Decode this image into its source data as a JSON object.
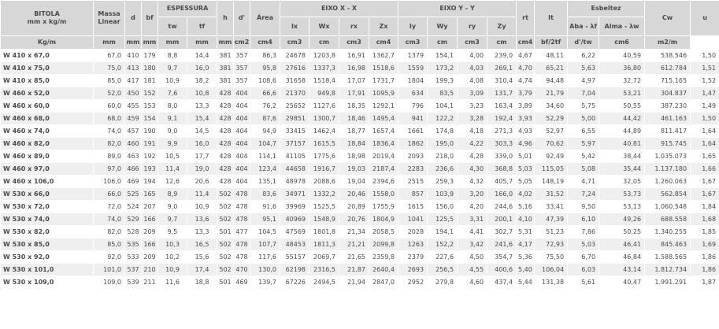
{
  "headers": {
    "bitola": "BITOLA",
    "bitola_unit": "mm x kg/m",
    "massa": "Massa Linear",
    "d": "d",
    "bf": "bf",
    "espessura": "ESPESSURA",
    "tw": "tw",
    "tf": "tf",
    "h": "h",
    "dlinha": "d'",
    "area": "Área",
    "eixo_x": "EIXO X - X",
    "ix": "Ix",
    "wx": "Wx",
    "rx": "rx",
    "zx": "Zx",
    "eixo_y": "EIXO Y - Y",
    "iy": "Iy",
    "wy": "Wy",
    "ry": "ry",
    "zy": "Zy",
    "rt": "rt",
    "it": "It",
    "esbeltez": "Esbeltez",
    "aba": "Aba - λf",
    "alma": "Alma - λw",
    "cw": "Cw",
    "u": "u"
  },
  "units": [
    "Kg/m",
    "mm",
    "mm",
    "mm",
    "mm",
    "mm",
    "mm",
    "cm2",
    "cm4",
    "cm3",
    "cm",
    "cm3",
    "cm4",
    "cm3",
    "cm",
    "cm3",
    "cm",
    "cm4",
    "bf/2tf",
    "d'/tw",
    "cm6",
    "m2/m"
  ],
  "rows": [
    [
      "W 410 x 67,0",
      "67,0",
      "410",
      "179",
      "8,8",
      "14,4",
      "381",
      "357",
      "86,3",
      "24678",
      "1203,8",
      "16,91",
      "1362,7",
      "1379",
      "154,1",
      "4,00",
      "239,0",
      "4,67",
      "48,11",
      "6,22",
      "40,59",
      "538.546",
      "1,50"
    ],
    [
      "W 410 x 75,0",
      "75,0",
      "413",
      "180",
      "9,7",
      "16,0",
      "381",
      "357",
      "95,8",
      "27616",
      "1337,3",
      "16,98",
      "1518,6",
      "1559",
      "173,2",
      "4,03",
      "269,1",
      "4,70",
      "65,21",
      "5,63",
      "36,80",
      "612.784",
      "1,51"
    ],
    [
      "W 410 x 85,0",
      "85,0",
      "417",
      "181",
      "10,9",
      "18,2",
      "381",
      "357",
      "108,6",
      "31658",
      "1518,4",
      "17,07",
      "1731,7",
      "1804",
      "199,3",
      "4,08",
      "310,4",
      "4,74",
      "94,48",
      "4,97",
      "32,72",
      "715.165",
      "1,52"
    ],
    [
      "W 460 x 52,0",
      "52,0",
      "450",
      "152",
      "7,6",
      "10,8",
      "428",
      "404",
      "66,6",
      "21370",
      "949,8",
      "17,91",
      "1095,9",
      "634",
      "83,5",
      "3,09",
      "131,7",
      "3,79",
      "21,79",
      "7,04",
      "53,21",
      "304.837",
      "1,47"
    ],
    [
      "W 460 x 60,0",
      "60,0",
      "455",
      "153",
      "8,0",
      "13,3",
      "428",
      "404",
      "76,2",
      "25652",
      "1127,6",
      "18,35",
      "1292,1",
      "796",
      "104,1",
      "3,23",
      "163,4",
      "3,89",
      "34,60",
      "5,75",
      "50,55",
      "387.230",
      "1,49"
    ],
    [
      "W 460 x 68,0",
      "68,0",
      "459",
      "154",
      "9,1",
      "15,4",
      "428",
      "404",
      "87,6",
      "29851",
      "1300,7",
      "18,46",
      "1495,4",
      "941",
      "122,2",
      "3,28",
      "192,4",
      "3,93",
      "52,29",
      "5,00",
      "44,42",
      "461.163",
      "1,50"
    ],
    [
      "W 460 x 74,0",
      "74,0",
      "457",
      "190",
      "9,0",
      "14,5",
      "428",
      "404",
      "94,9",
      "33415",
      "1462,4",
      "18,77",
      "1657,4",
      "1661",
      "174,8",
      "4,18",
      "271,3",
      "4,93",
      "52,97",
      "6,55",
      "44,89",
      "811.417",
      "1,64"
    ],
    [
      "W 460 x 82,0",
      "82,0",
      "460",
      "191",
      "9,9",
      "16,0",
      "428",
      "404",
      "104,7",
      "37157",
      "1615,5",
      "18,84",
      "1836,4",
      "1862",
      "195,0",
      "4,22",
      "303,3",
      "4,96",
      "70,62",
      "5,97",
      "40,81",
      "915.745",
      "1,64"
    ],
    [
      "W 460 x 89,0",
      "89,0",
      "463",
      "192",
      "10,5",
      "17,7",
      "428",
      "404",
      "114,1",
      "41105",
      "1775,6",
      "18,98",
      "2019,4",
      "2093",
      "218,0",
      "4,28",
      "339,0",
      "5,01",
      "92,49",
      "5,42",
      "38,44",
      "1.035.073",
      "1,65"
    ],
    [
      "W 460 x 97,0",
      "97,0",
      "466",
      "193",
      "11,4",
      "19,0",
      "428",
      "404",
      "123,4",
      "44658",
      "1916,7",
      "19,03",
      "2187,4",
      "2283",
      "236,6",
      "4,30",
      "368,8",
      "5,03",
      "115,05",
      "5,08",
      "35,44",
      "1.137.180",
      "1,66"
    ],
    [
      "W 460 x 106,0",
      "106,0",
      "469",
      "194",
      "12,6",
      "20,6",
      "428",
      "404",
      "135,1",
      "48978",
      "2088,6",
      "19,04",
      "2394,6",
      "2515",
      "259,3",
      "4,32",
      "405,7",
      "5,05",
      "148,19",
      "4,71",
      "32,05",
      "1.260.063",
      "1,67"
    ],
    [
      "W 530 x 66,0",
      "66,0",
      "525",
      "165",
      "8,9",
      "11,4",
      "502",
      "478",
      "83,6",
      "34971",
      "1332,2",
      "20,46",
      "1558,0",
      "857",
      "103,9",
      "3,20",
      "166,0",
      "4,02",
      "31,52",
      "7,24",
      "53,73",
      "562.854",
      "1,67"
    ],
    [
      "W 530 x 72,0",
      "72,0",
      "524",
      "207",
      "9,0",
      "10,9",
      "502",
      "478",
      "91,6",
      "39969",
      "1525,5",
      "20,89",
      "1755,9",
      "1615",
      "156,0",
      "4,20",
      "244,6",
      "5,16",
      "33,41",
      "9,50",
      "53,13",
      "1.060.548",
      "1,84"
    ],
    [
      "W 530 x 74,0",
      "74,0",
      "529",
      "166",
      "9,7",
      "13,6",
      "502",
      "478",
      "95,1",
      "40969",
      "1548,9",
      "20,76",
      "1804,9",
      "1041",
      "125,5",
      "3,31",
      "200,1",
      "4,10",
      "47,39",
      "6,10",
      "49,26",
      "688.558",
      "1,68"
    ],
    [
      "W 530 x 82,0",
      "82,0",
      "528",
      "209",
      "9,5",
      "13,3",
      "501",
      "477",
      "104,5",
      "47569",
      "1801,8",
      "21,34",
      "2058,5",
      "2028",
      "194,1",
      "4,41",
      "302,7",
      "5,31",
      "51,23",
      "7,86",
      "50,25",
      "1.340.255",
      "1,85"
    ],
    [
      "W 530 x 85,0",
      "85,0",
      "535",
      "166",
      "10,3",
      "16,5",
      "502",
      "478",
      "107,7",
      "48453",
      "1811,3",
      "21,21",
      "2099,8",
      "1263",
      "152,2",
      "3,42",
      "241,6",
      "4,17",
      "72,93",
      "5,03",
      "46,41",
      "845.463",
      "1,69"
    ],
    [
      "W 530 x 92,0",
      "92,0",
      "533",
      "209",
      "10,2",
      "15,6",
      "502",
      "478",
      "117,6",
      "55157",
      "2069,7",
      "21,65",
      "2359,8",
      "2379",
      "227,6",
      "4,50",
      "354,7",
      "5,36",
      "75,50",
      "6,70",
      "46,84",
      "1.588.565",
      "1,86"
    ],
    [
      "W 530 x 101,0",
      "101,0",
      "537",
      "210",
      "10,9",
      "17,4",
      "502",
      "470",
      "130,0",
      "62198",
      "2316,5",
      "21,87",
      "2640,4",
      "2693",
      "256,5",
      "4,55",
      "400,6",
      "5,40",
      "106,04",
      "6,03",
      "43,14",
      "1.812.734",
      "1,86"
    ],
    [
      "W 530 x 109,0",
      "109,0",
      "539",
      "211",
      "11,6",
      "18,8",
      "501",
      "469",
      "139,7",
      "67226",
      "2494,5",
      "21,94",
      "2847,0",
      "2952",
      "279,8",
      "4,60",
      "437,4",
      "5,44",
      "131,38",
      "5,61",
      "40,47",
      "1.991.291",
      "1,87"
    ]
  ]
}
